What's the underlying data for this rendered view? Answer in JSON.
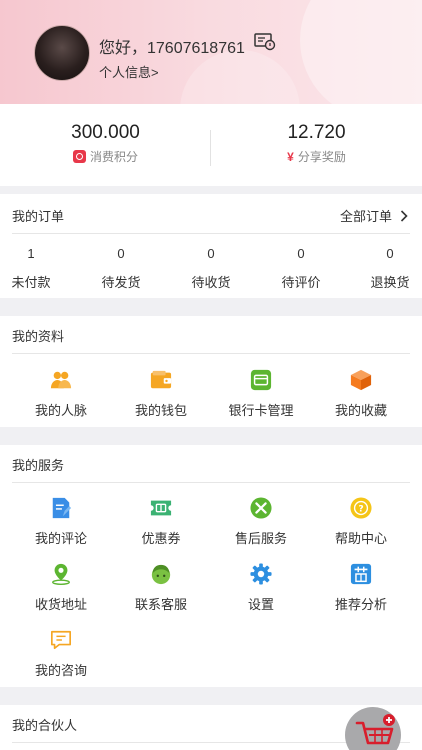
{
  "header": {
    "greeting": "您好，17607618761",
    "profile_link": "个人信息>"
  },
  "stats": {
    "points_value": "300.000",
    "points_label": "消费积分",
    "reward_value": "12.720",
    "reward_label": "分享奖励"
  },
  "orders": {
    "title": "我的订单",
    "all_label": "全部订单",
    "items": [
      {
        "count": "1",
        "label": "未付款"
      },
      {
        "count": "0",
        "label": "待发货"
      },
      {
        "count": "0",
        "label": "待收货"
      },
      {
        "count": "0",
        "label": "待评价"
      },
      {
        "count": "0",
        "label": "退换货"
      }
    ]
  },
  "profile": {
    "title": "我的资料",
    "items": [
      {
        "label": "我的人脉",
        "icon": "people-icon",
        "color": "#f5a623"
      },
      {
        "label": "我的钱包",
        "icon": "wallet-icon",
        "color": "#f5a623"
      },
      {
        "label": "银行卡管理",
        "icon": "bank-card-icon",
        "color": "#5cb531"
      },
      {
        "label": "我的收藏",
        "icon": "cube-icon",
        "color": "#f57b1f"
      }
    ]
  },
  "services": {
    "title": "我的服务",
    "items": [
      {
        "label": "我的评论",
        "icon": "comment-icon",
        "color": "#3a8ee6"
      },
      {
        "label": "优惠券",
        "icon": "coupon-icon",
        "color": "#3bb273"
      },
      {
        "label": "售后服务",
        "icon": "tools-icon",
        "color": "#5cb531"
      },
      {
        "label": "帮助中心",
        "icon": "help-icon",
        "color": "#f5c518"
      },
      {
        "label": "收货地址",
        "icon": "location-icon",
        "color": "#5cb531"
      },
      {
        "label": "联系客服",
        "icon": "support-icon",
        "color": "#7ac142"
      },
      {
        "label": "设置",
        "icon": "gear-icon",
        "color": "#2d8fe0"
      },
      {
        "label": "推荐分析",
        "icon": "recommend-icon",
        "color": "#2d8fe0"
      },
      {
        "label": "我的咨询",
        "icon": "consult-icon",
        "color": "#f5a623"
      }
    ]
  },
  "partner": {
    "title": "我的合伙人"
  }
}
